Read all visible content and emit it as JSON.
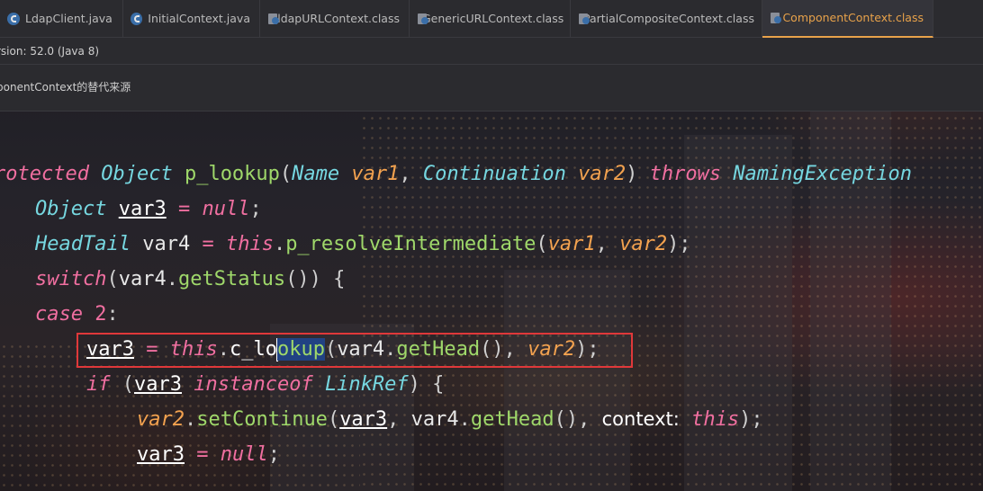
{
  "tabs": [
    {
      "label": "LdapClient.java",
      "icon": "java-file-icon",
      "active": false
    },
    {
      "label": "InitialContext.java",
      "icon": "java-file-icon",
      "active": false
    },
    {
      "label": "ldapURLContext.class",
      "icon": "class-file-icon",
      "active": false
    },
    {
      "label": "GenericURLContext.class",
      "icon": "class-file-icon",
      "active": false
    },
    {
      "label": "PartialCompositeContext.class",
      "icon": "class-file-icon",
      "active": false
    },
    {
      "label": "ComponentContext.class",
      "icon": "class-file-icon",
      "active": true
    }
  ],
  "info": {
    "bytecode_version": "rsion: 52.0 (Java 8)",
    "source_notice": "ponentContext的替代来源"
  },
  "code": {
    "l1": {
      "a": "rotected",
      "b": "Object",
      "c": "p_lookup",
      "d": "Name",
      "e": "var1",
      "f": "Continuation",
      "g": "var2",
      "h": "throws",
      "i": "NamingException"
    },
    "l2": {
      "a": "Object",
      "b": "var3",
      "c": "=",
      "d": "null",
      "e": ";"
    },
    "l3": {
      "a": "HeadTail",
      "b": "var4",
      "c": "=",
      "d": "this",
      "e": ".",
      "f": "p_resolveIntermediate",
      "g": "var1",
      "h": "var2"
    },
    "l4": {
      "a": "switch",
      "b": "var4",
      "c": "getStatus",
      "d": "()) {"
    },
    "l5": {
      "a": "case",
      "b": "2",
      "c": ":"
    },
    "l6": {
      "a": "var3",
      "b": "=",
      "c": "this",
      "d": "c_lo",
      "e": "okup",
      "f": "var4",
      "g": "getHead",
      "h": "var2"
    },
    "l7": {
      "a": "if",
      "b": "var3",
      "c": "instanceof",
      "d": "LinkRef",
      "e": ") {"
    },
    "l8": {
      "a": "var2",
      "b": "setContinue",
      "c": "var3",
      "d": "var4",
      "e": "getHead",
      "f": "context:",
      "g": "this"
    },
    "l9": {
      "a": "var3",
      "b": "=",
      "c": "null",
      "d": ";"
    }
  },
  "colors": {
    "accent": "#e8a24a",
    "keyword": "#f06fa0",
    "type": "#76d7e0",
    "method": "#9fd86a",
    "param": "#f3a24f",
    "highlight_border": "#e0383a"
  }
}
